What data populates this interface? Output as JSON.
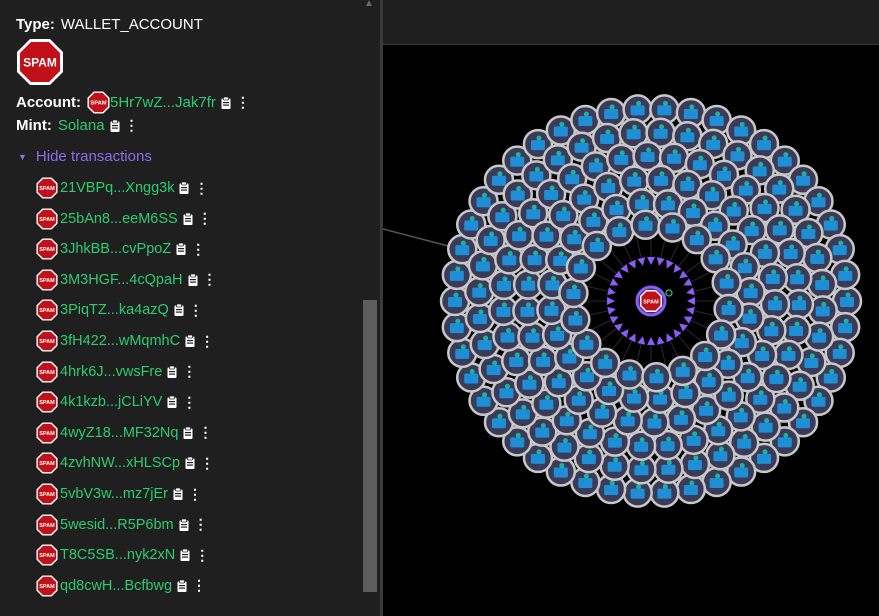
{
  "details": {
    "type_label": "Type:",
    "type_value": "WALLET_ACCOUNT",
    "badge_text": "SPAM",
    "account_label": "Account:",
    "account_value": "5Hr7wZ...Jak7fr",
    "mint_label": "Mint:",
    "mint_value": "Solana",
    "toggle_label": "Hide transactions"
  },
  "transactions": [
    "21VBPq...Xngg3k",
    "25bAn8...eeM6SS",
    "3JhkBB...cvPpoZ",
    "3M3HGF...4cQpaH",
    "3PiqTZ...ka4azQ",
    "3fH422...wMqmhC",
    "4hrk6J...vwsFre",
    "4k1kzb...jCLiYV",
    "4wyZ18...MF32Nq",
    "4zvhNW...xHLSCp",
    "5vbV3w...mz7jEr",
    "5wesid...R5P6bm",
    "T8C5SB...nyk2xN",
    "qd8cwH...Bcfbwg"
  ],
  "colors": {
    "link": "#2ecc71",
    "toggle": "#8a6cf0",
    "spam_red": "#c0101a",
    "node_ring": "#c8c8c8",
    "node_fill": "#3b3b58",
    "wallet_blue": "#1e8fd6",
    "arrow_purple": "#8b5cf6"
  },
  "icons": [
    "spam-stop-icon",
    "clipboard-icon",
    "more-vert-icon",
    "triangle-down-icon",
    "wallet-icon"
  ],
  "graph": {
    "center_label": "SPAM"
  }
}
